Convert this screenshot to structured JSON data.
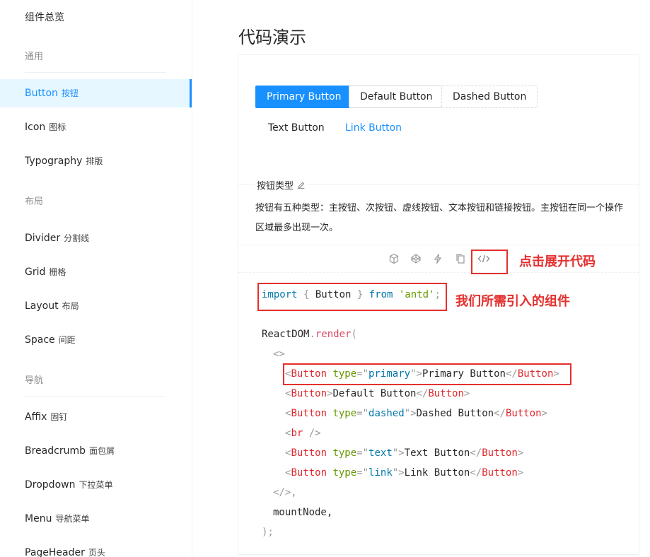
{
  "sidebar": {
    "top": "组件总览",
    "groups": [
      "通用",
      "布局",
      "导航"
    ],
    "items": [
      {
        "en": "Button",
        "cn": "按钮"
      },
      {
        "en": "Icon",
        "cn": "图标"
      },
      {
        "en": "Typography",
        "cn": "排版"
      },
      {
        "en": "Divider",
        "cn": "分割线"
      },
      {
        "en": "Grid",
        "cn": "栅格"
      },
      {
        "en": "Layout",
        "cn": "布局"
      },
      {
        "en": "Space",
        "cn": "间距"
      },
      {
        "en": "Affix",
        "cn": "固钉"
      },
      {
        "en": "Breadcrumb",
        "cn": "面包屑"
      },
      {
        "en": "Dropdown",
        "cn": "下拉菜单"
      },
      {
        "en": "Menu",
        "cn": "导航菜单"
      },
      {
        "en": "PageHeader",
        "cn": "页头"
      }
    ]
  },
  "main": {
    "title": "代码演示",
    "buttons": [
      "Primary Button",
      "Default Button",
      "Dashed Button",
      "Text Button",
      "Link Button"
    ],
    "meta_title": "按钮类型",
    "meta_desc": "按钮有五种类型：主按钮、次按钮、虚线按钮、文本按钮和链接按钮。主按钮在同一个操作区域最多出现一次。",
    "code": {
      "import_kw": "import",
      "import_name": "Button",
      "from_kw": "from",
      "module": "'antd'",
      "reactdom": "ReactDOM",
      "render": "render",
      "mount": "mountNode,",
      "buttons": [
        {
          "type": "primary",
          "label": "Primary Button"
        },
        {
          "type": "",
          "label": "Default Button"
        },
        {
          "type": "dashed",
          "label": "Dashed Button"
        },
        {
          "type": "text",
          "label": "Text Button"
        },
        {
          "type": "link",
          "label": "Link Button"
        }
      ]
    }
  },
  "annotations": {
    "expand": "点击展开代码",
    "import": "我们所需引入的组件"
  },
  "colors": {
    "primary": "#1890ff",
    "annotation": "#e5302e"
  }
}
